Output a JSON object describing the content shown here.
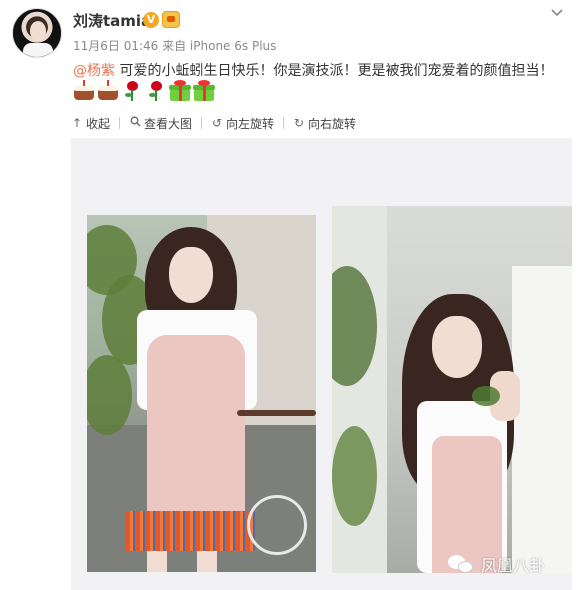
{
  "post": {
    "username": "刘涛tamia",
    "verified_badge": "V",
    "meta": "11月6日 01:46 来自 iPhone 6s Plus",
    "mention": "@杨紫",
    "text": " 可爱的小蚯蚓生日快乐！你是演技派！更是被我们宠爱着的颜值担当！",
    "emojis": [
      "cake-icon",
      "cake-icon",
      "rose-icon",
      "rose-icon",
      "gift-icon",
      "gift-icon"
    ]
  },
  "toolbar": {
    "collapse_label": "收起",
    "view_large_label": "查看大图",
    "rotate_left_label": "向左旋转",
    "rotate_right_label": "向右旋转"
  },
  "watermark": {
    "text": "凤凰八卦"
  },
  "colors": {
    "mention": "#eb7350",
    "verified": "#f5a623",
    "media_bg": "#f2f2f5"
  }
}
